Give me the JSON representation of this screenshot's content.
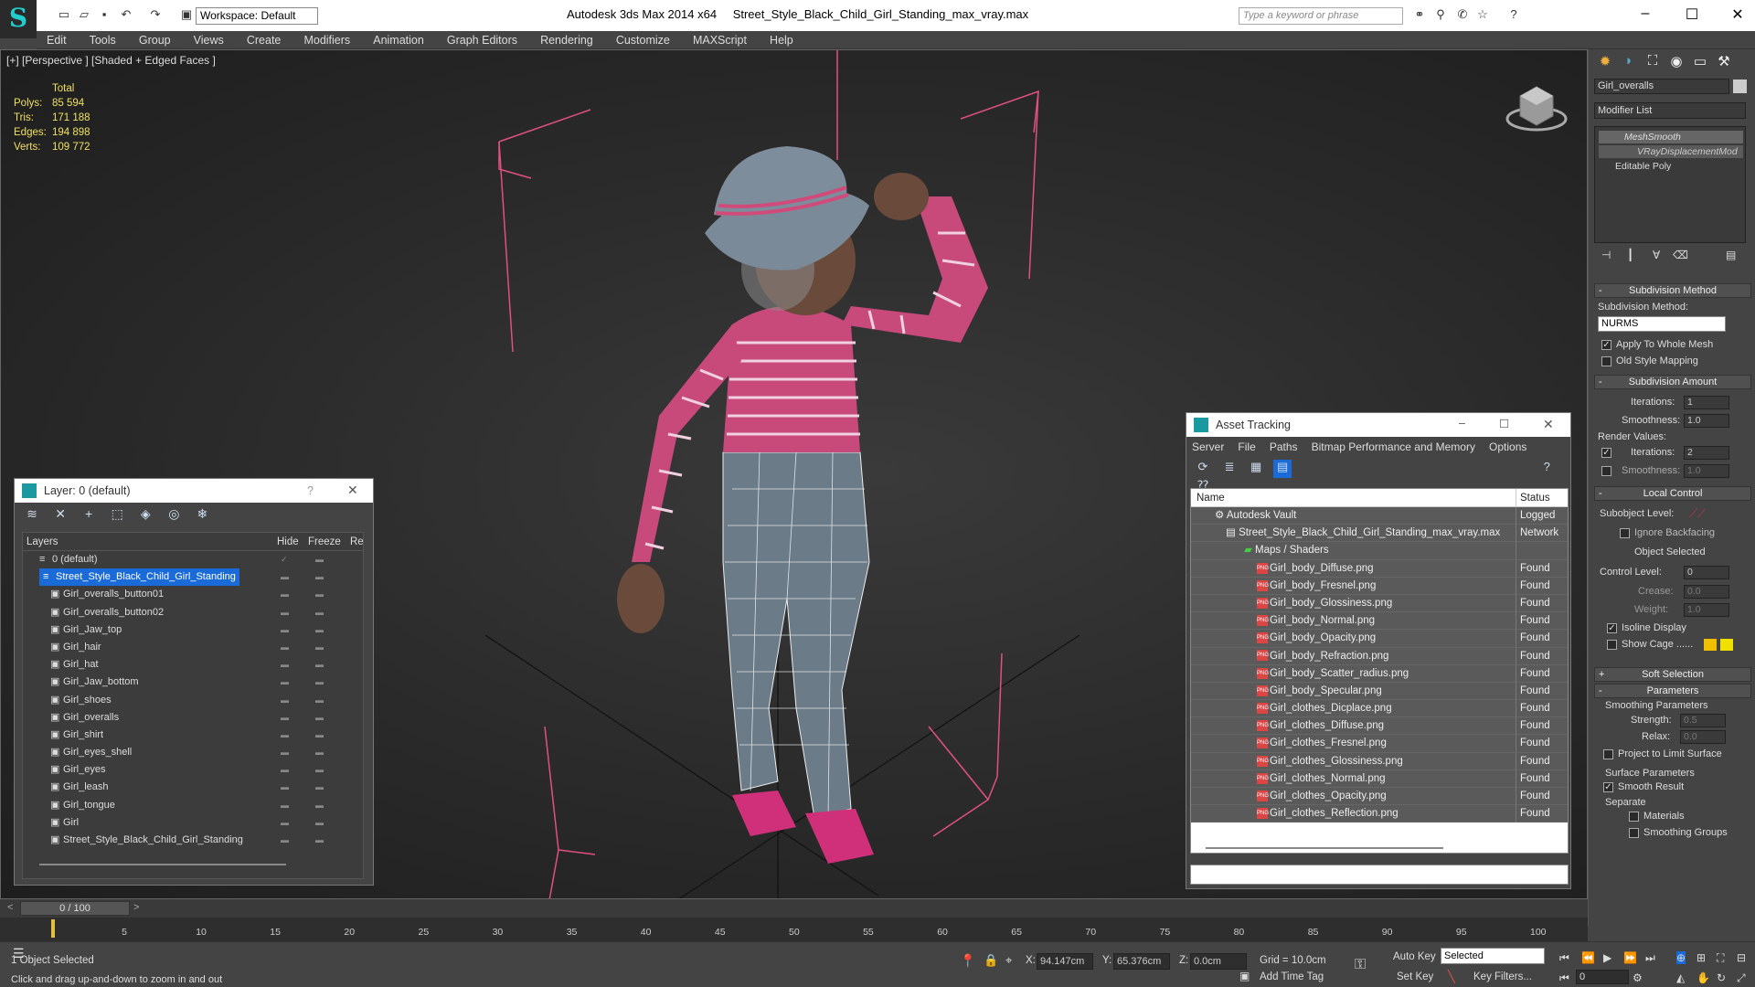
{
  "titlebar": {
    "app": "Autodesk 3ds Max  2014 x64",
    "file": "Street_Style_Black_Child_Girl_Standing_max_vray.max",
    "workspace": "Workspace: Default",
    "search_placeholder": "Type a keyword or phrase"
  },
  "menubar": [
    "Edit",
    "Tools",
    "Group",
    "Views",
    "Create",
    "Modifiers",
    "Animation",
    "Graph Editors",
    "Rendering",
    "Customize",
    "MAXScript",
    "Help"
  ],
  "viewport": {
    "label": "[+] [Perspective ] [Shaded + Edged Faces ]",
    "stats": {
      "total_label": "Total",
      "rows": [
        {
          "label": "Polys:",
          "value": "85 594"
        },
        {
          "label": "Tris:",
          "value": "171 188"
        },
        {
          "label": "Edges:",
          "value": "194 898"
        },
        {
          "label": "Verts:",
          "value": "109 772"
        }
      ]
    }
  },
  "command_panel": {
    "object_name": "Girl_overalls",
    "modifier_list": "Modifier List",
    "stack": [
      "MeshSmooth",
      "VRayDisplacementMod",
      "Editable Poly"
    ],
    "subdivision_method": {
      "title": "Subdivision Method",
      "label": "Subdivision Method:",
      "value": "NURMS",
      "apply_whole": "Apply To Whole Mesh",
      "old_style": "Old Style Mapping"
    },
    "subdivision_amount": {
      "title": "Subdivision Amount",
      "iterations_label": "Iterations:",
      "iterations": "1",
      "smoothness_label": "Smoothness:",
      "smoothness": "1.0",
      "render_values": "Render Values:",
      "r_iterations_label": "Iterations:",
      "r_iterations": "2",
      "r_smoothness_label": "Smoothness:",
      "r_smoothness": "1.0"
    },
    "local_control": {
      "title": "Local Control",
      "subobject": "Subobject Level:",
      "ignore_backfacing": "Ignore Backfacing",
      "object_selected": "Object Selected",
      "control_level_label": "Control Level:",
      "control_level": "0",
      "crease_label": "Crease:",
      "crease": "0.0",
      "weight_label": "Weight:",
      "weight": "1.0",
      "isoline": "Isoline Display",
      "show_cage": "Show Cage ......"
    },
    "soft_selection": "Soft Selection",
    "parameters": {
      "title": "Parameters",
      "smoothing": "Smoothing Parameters",
      "strength_label": "Strength:",
      "strength": "0.5",
      "relax_label": "Relax:",
      "relax": "0.0",
      "project": "Project to Limit Surface",
      "surface": "Surface Parameters",
      "smooth_result": "Smooth Result",
      "separate": "Separate",
      "materials": "Materials",
      "smoothing_groups": "Smoothing Groups"
    }
  },
  "layer_window": {
    "title": "Layer: 0 (default)",
    "help": "?",
    "columns": [
      "Layers",
      "Hide",
      "Freeze",
      "Re"
    ],
    "layers": [
      {
        "name": "0 (default)",
        "level": 1
      },
      {
        "name": "Street_Style_Black_Child_Girl_Standing",
        "level": 1,
        "selected": true
      },
      {
        "name": "Girl_overalls_button01",
        "level": 2
      },
      {
        "name": "Girl_overalls_button02",
        "level": 2
      },
      {
        "name": "Girl_Jaw_top",
        "level": 2
      },
      {
        "name": "Girl_hair",
        "level": 2
      },
      {
        "name": "Girl_hat",
        "level": 2
      },
      {
        "name": "Girl_Jaw_bottom",
        "level": 2
      },
      {
        "name": "Girl_shoes",
        "level": 2
      },
      {
        "name": "Girl_overalls",
        "level": 2
      },
      {
        "name": "Girl_shirt",
        "level": 2
      },
      {
        "name": "Girl_eyes_shell",
        "level": 2
      },
      {
        "name": "Girl_eyes",
        "level": 2
      },
      {
        "name": "Girl_leash",
        "level": 2
      },
      {
        "name": "Girl_tongue",
        "level": 2
      },
      {
        "name": "Girl",
        "level": 2
      },
      {
        "name": "Street_Style_Black_Child_Girl_Standing",
        "level": 2
      }
    ]
  },
  "asset_window": {
    "title": "Asset Tracking",
    "menu": [
      "Server",
      "File",
      "Paths",
      "Bitmap Performance and Memory",
      "Options"
    ],
    "columns": [
      "Name",
      "Status"
    ],
    "rows": [
      {
        "name": "Autodesk Vault",
        "status": "Logged Ou",
        "level": 0
      },
      {
        "name": "Street_Style_Black_Child_Girl_Standing_max_vray.max",
        "status": "Network P",
        "level": 1
      },
      {
        "name": "Maps / Shaders",
        "status": "",
        "level": 2
      },
      {
        "name": "Girl_body_Diffuse.png",
        "status": "Found",
        "level": 3
      },
      {
        "name": "Girl_body_Fresnel.png",
        "status": "Found",
        "level": 3
      },
      {
        "name": "Girl_body_Glossiness.png",
        "status": "Found",
        "level": 3
      },
      {
        "name": "Girl_body_Normal.png",
        "status": "Found",
        "level": 3
      },
      {
        "name": "Girl_body_Opacity.png",
        "status": "Found",
        "level": 3
      },
      {
        "name": "Girl_body_Refraction.png",
        "status": "Found",
        "level": 3
      },
      {
        "name": "Girl_body_Scatter_radius.png",
        "status": "Found",
        "level": 3
      },
      {
        "name": "Girl_body_Specular.png",
        "status": "Found",
        "level": 3
      },
      {
        "name": "Girl_clothes_Dicplace.png",
        "status": "Found",
        "level": 3
      },
      {
        "name": "Girl_clothes_Diffuse.png",
        "status": "Found",
        "level": 3
      },
      {
        "name": "Girl_clothes_Fresnel.png",
        "status": "Found",
        "level": 3
      },
      {
        "name": "Girl_clothes_Glossiness.png",
        "status": "Found",
        "level": 3
      },
      {
        "name": "Girl_clothes_Normal.png",
        "status": "Found",
        "level": 3
      },
      {
        "name": "Girl_clothes_Opacity.png",
        "status": "Found",
        "level": 3
      },
      {
        "name": "Girl_clothes_Reflection.png",
        "status": "Found",
        "level": 3
      }
    ]
  },
  "timeline": {
    "frame": "0 / 100",
    "ticks": [
      "5",
      "10",
      "15",
      "20",
      "25",
      "30",
      "35",
      "40",
      "45",
      "50",
      "55",
      "60",
      "65",
      "70",
      "75",
      "80",
      "85",
      "90",
      "95",
      "100"
    ]
  },
  "statusbar": {
    "selection": "1 Object Selected",
    "prompt": "Click and drag up-and-down to zoom in and out",
    "x_label": "X:",
    "x": "94.147cm",
    "y_label": "Y:",
    "y": "65.376cm",
    "z_label": "Z:",
    "z": "0.0cm",
    "grid": "Grid = 10.0cm",
    "auto_key": "Auto Key",
    "set_key": "Set Key",
    "selected": "Selected",
    "key_filters": "Key Filters...",
    "add_time_tag": "Add Time Tag",
    "frame_value": "0"
  },
  "colors": {
    "accent_blue": "#1a6ad8",
    "stat_yellow": "#f0e060",
    "bbox_pink": "#e05080",
    "swatch_yellow": "#f0c000"
  }
}
